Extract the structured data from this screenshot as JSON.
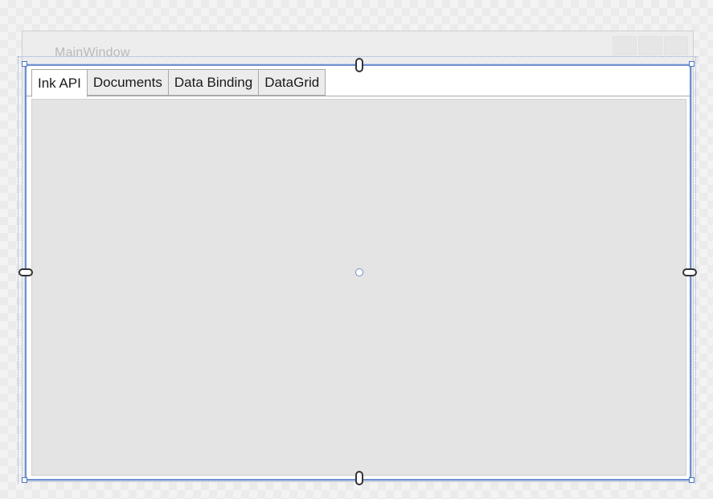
{
  "window": {
    "title": "MainWindow"
  },
  "tab_control": {
    "tabs": [
      {
        "label": "Ink API",
        "active": true
      },
      {
        "label": "Documents",
        "active": false
      },
      {
        "label": "Data Binding",
        "active": false
      },
      {
        "label": "DataGrid",
        "active": false
      }
    ]
  },
  "colors": {
    "selection_border": "#6f8fce",
    "content_background": "#e4e4e4",
    "title_text": "#b9b9b9"
  }
}
